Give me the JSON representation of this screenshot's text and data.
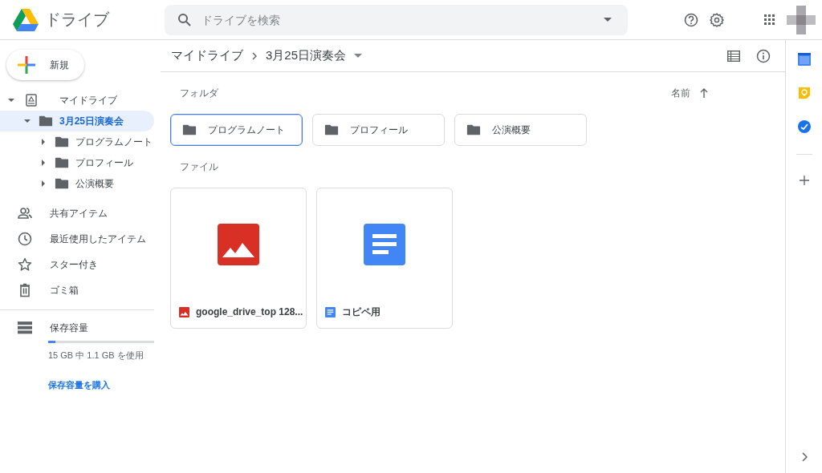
{
  "header": {
    "app_name": "ドライブ",
    "search": {
      "placeholder": "ドライブを検索"
    }
  },
  "sidebar": {
    "new_button": "新規",
    "tree": [
      {
        "label": "マイドライブ",
        "kind": "drive",
        "expanded": true,
        "selected": false,
        "children": [
          {
            "label": "3月25日演奏会",
            "kind": "folder",
            "expanded": true,
            "selected": true,
            "children": [
              {
                "label": "プログラムノート",
                "kind": "folder",
                "expanded": false,
                "selected": false
              },
              {
                "label": "プロフィール",
                "kind": "folder",
                "expanded": false,
                "selected": false
              },
              {
                "label": "公演概要",
                "kind": "folder",
                "expanded": false,
                "selected": false
              }
            ]
          }
        ]
      }
    ],
    "nav": [
      {
        "label": "共有アイテム",
        "kind": "shared"
      },
      {
        "label": "最近使用したアイテム",
        "kind": "recent"
      },
      {
        "label": "スター付き",
        "kind": "starred"
      },
      {
        "label": "ゴミ箱",
        "kind": "trash"
      }
    ],
    "storage": {
      "label": "保存容量",
      "level": 0.07,
      "usage": "15 GB 中 1.1 GB を使用",
      "buy_link": "保存容量を購入"
    }
  },
  "breadcrumb": [
    "マイドライブ",
    "3月25日演奏会"
  ],
  "folders_heading": "フォルダ",
  "sort": {
    "label": "名前"
  },
  "folders": [
    {
      "name": "プログラムノート",
      "selected": true
    },
    {
      "name": "プロフィール",
      "selected": false
    },
    {
      "name": "公演概要",
      "selected": false
    }
  ],
  "files_heading": "ファイル",
  "files": [
    {
      "name": "google_drive_top 128...",
      "kind": "image"
    },
    {
      "name": "コピペ用",
      "kind": "doc"
    }
  ]
}
